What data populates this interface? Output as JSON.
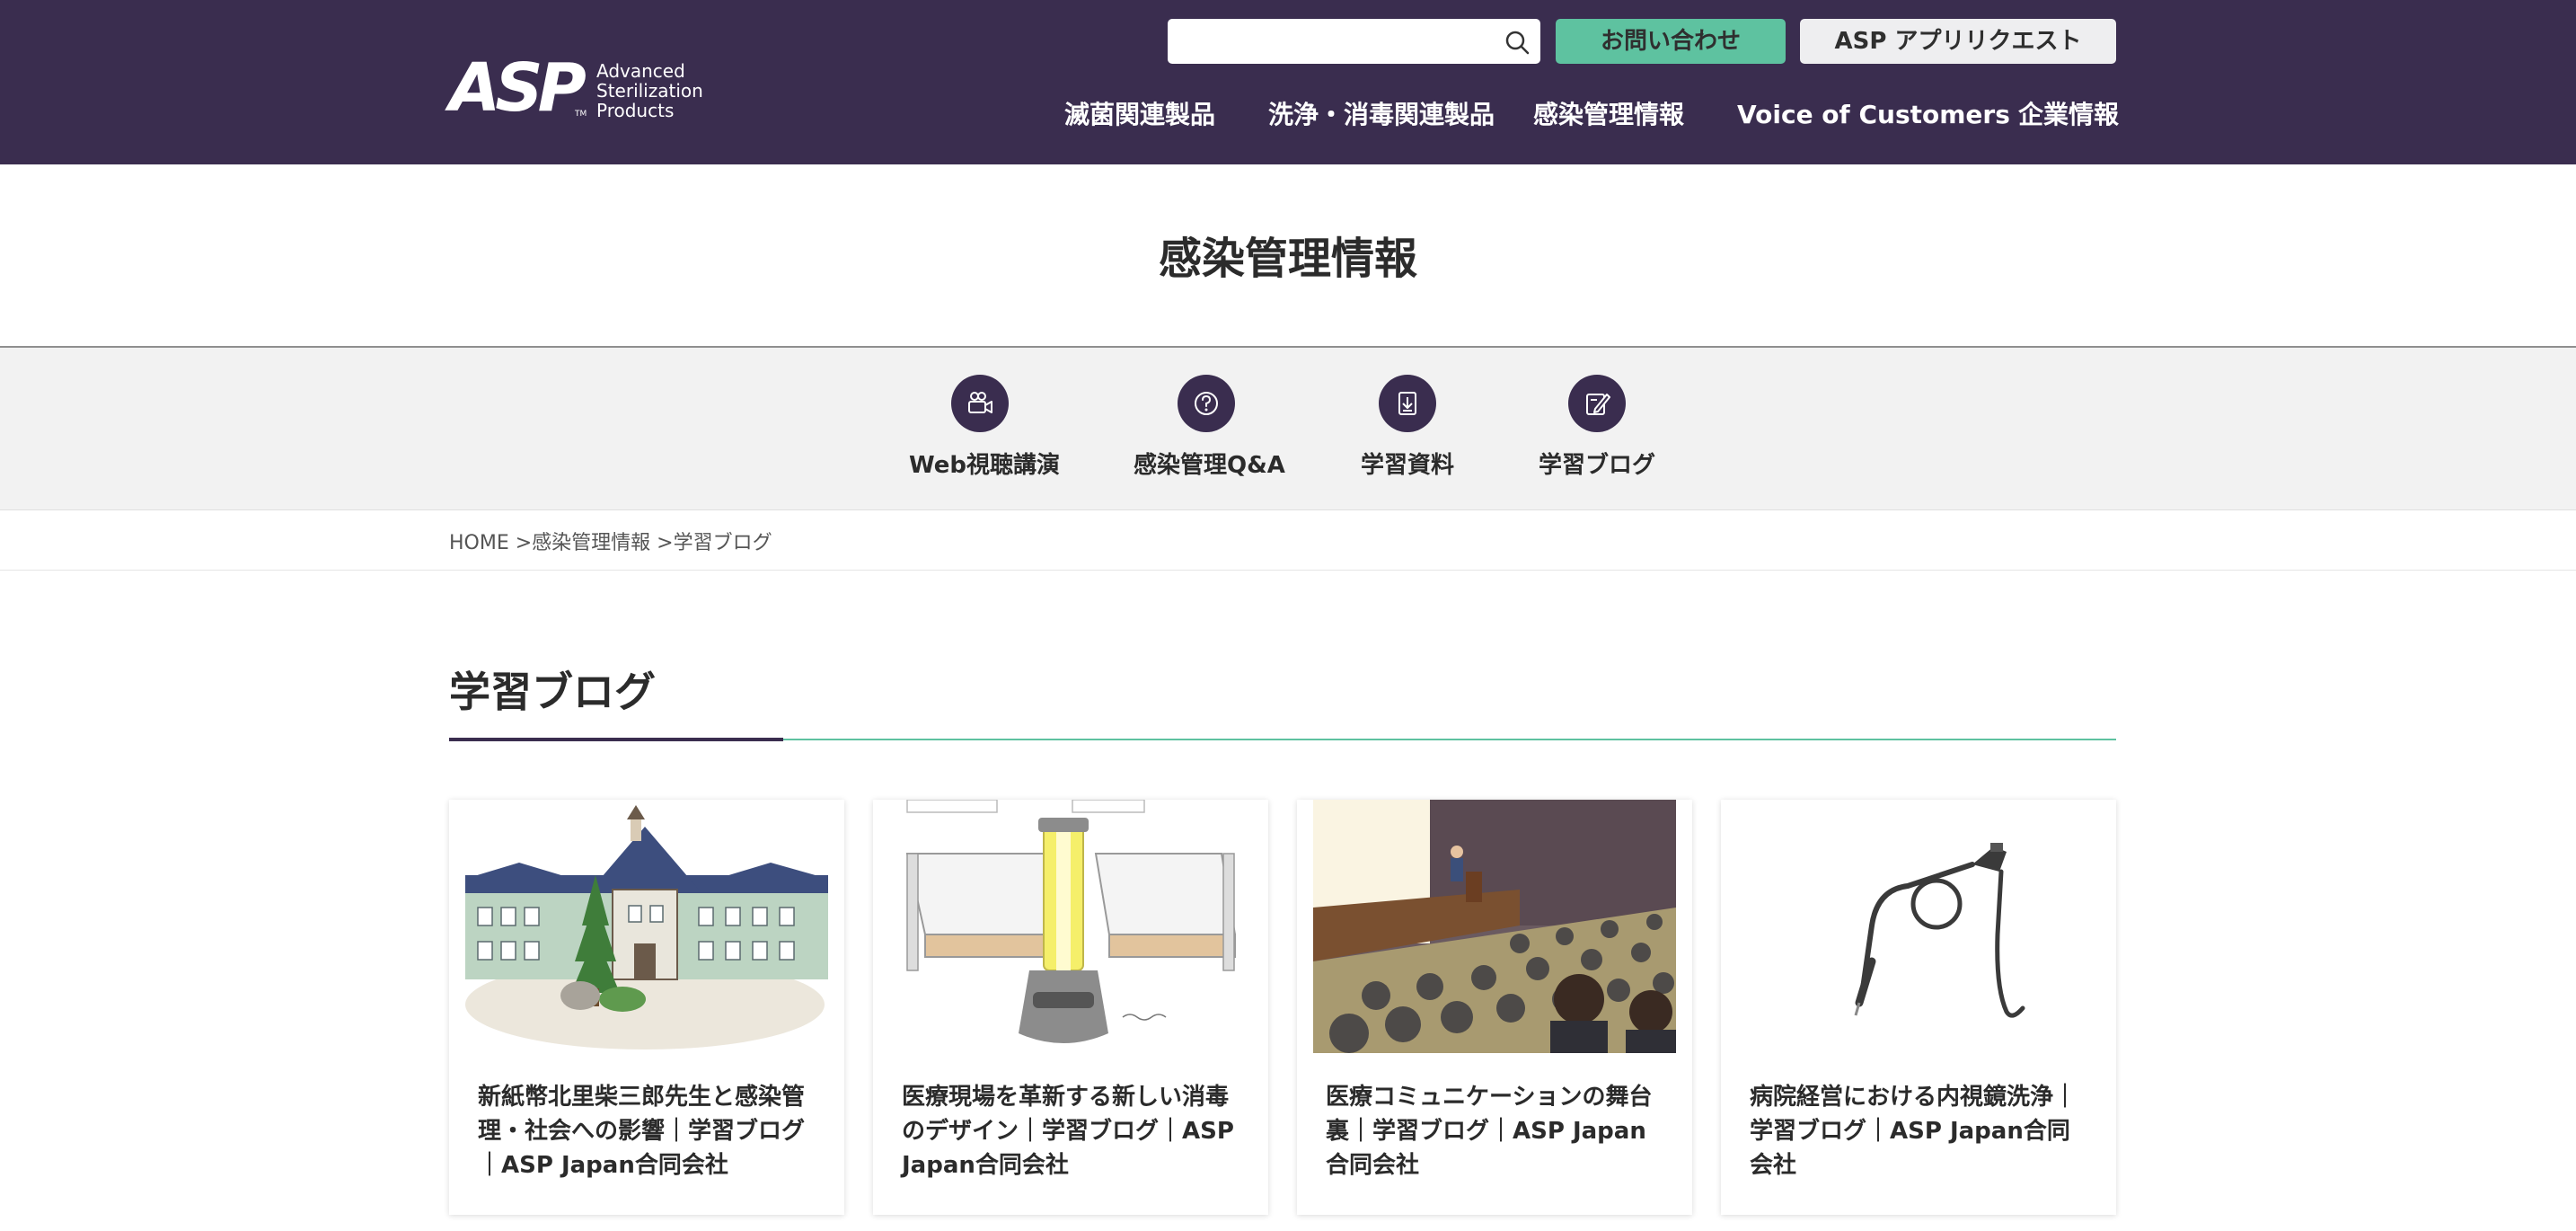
{
  "header": {
    "logo": {
      "mark": "ASP",
      "tm": "TM",
      "line1": "Advanced",
      "line2": "Sterilization",
      "line3": "Products"
    },
    "search": {
      "value": "",
      "placeholder": ""
    },
    "contact_button": "お問い合わせ",
    "app_request_button": "ASP アプリリクエスト",
    "nav": [
      "滅菌関連製品",
      "洗浄・消毒関連製品",
      "感染管理情報",
      "Voice of Customers",
      "企業情報"
    ]
  },
  "page_title": "感染管理情報",
  "subnav": [
    {
      "label": "Web視聴講演",
      "icon": "video-lecture-icon"
    },
    {
      "label": "感染管理Q&A",
      "icon": "question-icon"
    },
    {
      "label": "学習資料",
      "icon": "download-document-icon"
    },
    {
      "label": "学習ブログ",
      "icon": "blog-pen-icon"
    }
  ],
  "breadcrumb": "HOME >感染管理情報 >学習ブログ",
  "section_title": "学習ブログ",
  "cards": [
    {
      "title": "新紙幣北里柴三郎先生と感染管理・社会への影響｜学習ブログ｜ASP Japan合同会社",
      "image": "hospital-building-illustration"
    },
    {
      "title": "医療現場を革新する新しい消毒のデザイン｜学習ブログ｜ASP Japan合同会社",
      "image": "disinfection-robot-illustration"
    },
    {
      "title": "医療コミュニケーションの舞台裏｜学習ブログ｜ASP Japan合同会社",
      "image": "lecture-hall-illustration"
    },
    {
      "title": "病院経営における内視鏡洗浄｜学習ブログ｜ASP Japan合同会社",
      "image": "endoscope-illustration"
    }
  ],
  "colors": {
    "header_bg": "#3a2d4f",
    "accent_green": "#5ec2a0",
    "subnav_bg": "#f2f2f2"
  }
}
